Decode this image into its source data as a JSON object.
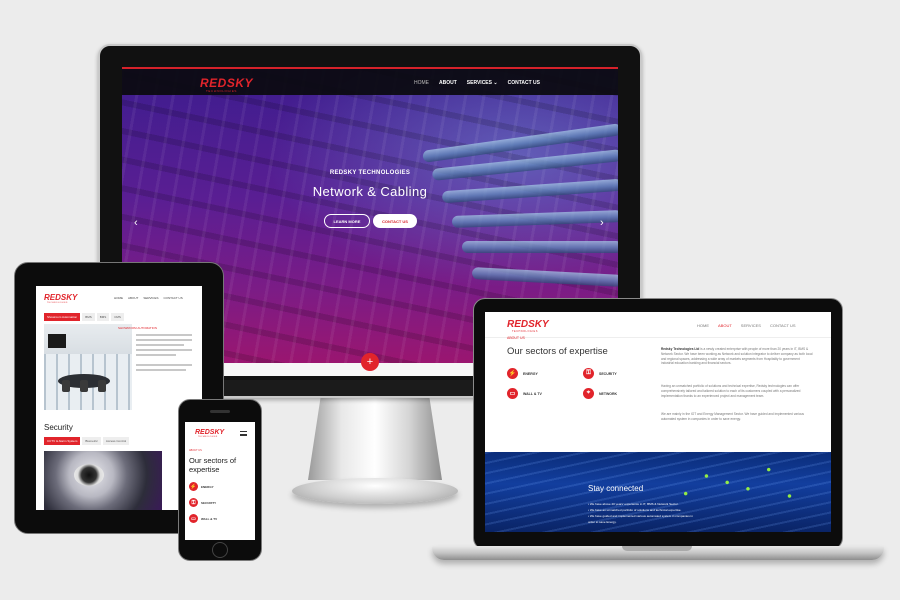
{
  "brand": {
    "name": "REDSKY",
    "tagline": "TECHNOLOGIES",
    "accent": "#e1242b"
  },
  "desktop": {
    "nav": [
      "HOME",
      "ABOUT",
      "SERVICES",
      "CONTACT US"
    ],
    "services_caret": "⌄",
    "hero_kicker": "REDSKY TECHNOLOGIES",
    "hero_title": "Network & Cabling",
    "btn_primary": "LEARN MORE",
    "btn_secondary": "CONTACT US",
    "prev_arrow": "‹",
    "next_arrow": "›",
    "fab_icon": "+"
  },
  "tablet": {
    "nav": [
      "HOME",
      "ABOUT",
      "SERVICES",
      "CONTACT US"
    ],
    "tabs_top": [
      "Showroom Automation",
      "BMS",
      "BMS",
      "CMS"
    ],
    "caption": "SHOWROOM AUTOMATION",
    "section_title": "Security",
    "tabs_bottom": [
      "CCTV & Alarm System",
      "Biometric",
      "Access Control"
    ]
  },
  "phone": {
    "kicker": "ABOUT US",
    "title": "Our sectors of expertise",
    "items": [
      {
        "label": "ENERGY",
        "icon": "bolt-icon",
        "glyph": "⚡"
      },
      {
        "label": "SECURITY",
        "icon": "lock-icon",
        "glyph": "⚿"
      },
      {
        "label": "WALL & TV",
        "icon": "tv-icon",
        "glyph": "▭"
      }
    ]
  },
  "laptop": {
    "nav": [
      "HOME",
      "ABOUT",
      "SERVICES",
      "CONTACT US"
    ],
    "kicker": "ABOUT US",
    "title": "Our sectors of expertise",
    "sectors": [
      {
        "label": "ENERGY",
        "icon": "bolt-icon",
        "glyph": "⚡"
      },
      {
        "label": "SECURITY",
        "icon": "lock-icon",
        "glyph": "⚿"
      },
      {
        "label": "WALL & TV",
        "icon": "tv-icon",
        "glyph": "▭"
      },
      {
        "label": "NETWORK",
        "icon": "network-icon",
        "glyph": "⌖"
      }
    ],
    "para_1_lead": "Redsky Technologies Ltd",
    "para_1": "is a newly created enterprise with people of more than 20 years in IT, BMS & Network Sector. We have been working as Network and solution integrator to deliver company as both local and regional spaces, addressing a wide array of markets segments from Hospitality to government industrial education banking and financial sectors.",
    "para_2": "Having an unmatched portfolio of solutions and technical expertise, Redsky technologies can offer comprehensively tailored and tailored solution to each of its customers coupled with a personalized implementation thanks to an experienced project and management team.",
    "para_3": "We are mainly in the IOT and Energy Management Sector. We have guided and implemented various automated system in companies in order to save energy.",
    "band_title": "Stay connected",
    "bullets": [
      "• We have above 20 years' experience in IT, BMS & Network Sector.",
      "• We have an unmatched portfolio of solutions and technical expertise.",
      "• We have guided and implemented various automated system in companies in",
      "  order to save Energy."
    ]
  }
}
